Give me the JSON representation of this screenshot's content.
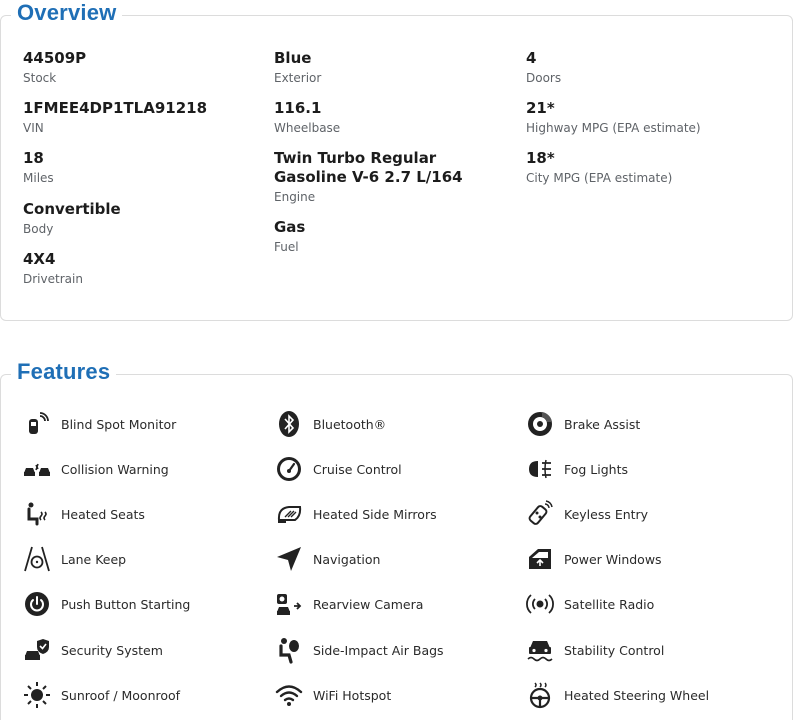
{
  "overview": {
    "title": "Overview",
    "specs": [
      {
        "value": "44509P",
        "label": "Stock"
      },
      {
        "value": "1FMEE4DP1TLA91218",
        "label": "VIN"
      },
      {
        "value": "18",
        "label": "Miles"
      },
      {
        "value": "Convertible",
        "label": "Body"
      },
      {
        "value": "4X4",
        "label": "Drivetrain"
      },
      {
        "value": "Blue",
        "label": "Exterior"
      },
      {
        "value": "116.1",
        "label": "Wheelbase"
      },
      {
        "value": "Twin Turbo Regular Gasoline V-6 2.7 L/164",
        "label": "Engine"
      },
      {
        "value": "Gas",
        "label": "Fuel"
      },
      {
        "value": "4",
        "label": "Doors"
      },
      {
        "value": "21*",
        "label": "Highway MPG (EPA estimate)"
      },
      {
        "value": "18*",
        "label": "City MPG (EPA estimate)"
      }
    ]
  },
  "features": {
    "title": "Features",
    "items": [
      {
        "label": "Blind Spot Monitor",
        "icon": "blind-spot-icon"
      },
      {
        "label": "Collision Warning",
        "icon": "collision-warning-icon"
      },
      {
        "label": "Heated Seats",
        "icon": "heated-seat-icon"
      },
      {
        "label": "Lane Keep",
        "icon": "lane-keep-icon"
      },
      {
        "label": "Push Button Starting",
        "icon": "power-button-icon"
      },
      {
        "label": "Security System",
        "icon": "security-shield-icon"
      },
      {
        "label": "Sunroof / Moonroof",
        "icon": "sun-icon"
      },
      {
        "label": "Bluetooth®",
        "icon": "bluetooth-icon"
      },
      {
        "label": "Cruise Control",
        "icon": "speedometer-icon"
      },
      {
        "label": "Heated Side Mirrors",
        "icon": "heated-mirror-icon"
      },
      {
        "label": "Navigation",
        "icon": "navigation-arrow-icon"
      },
      {
        "label": "Rearview Camera",
        "icon": "rearview-camera-icon"
      },
      {
        "label": "Side-Impact Air Bags",
        "icon": "airbag-icon"
      },
      {
        "label": "WiFi Hotspot",
        "icon": "wifi-icon"
      },
      {
        "label": "Brake Assist",
        "icon": "brake-disc-icon"
      },
      {
        "label": "Fog Lights",
        "icon": "fog-light-icon"
      },
      {
        "label": "Keyless Entry",
        "icon": "key-fob-icon"
      },
      {
        "label": "Power Windows",
        "icon": "power-window-icon"
      },
      {
        "label": "Satellite Radio",
        "icon": "satellite-radio-icon"
      },
      {
        "label": "Stability Control",
        "icon": "stability-control-icon"
      },
      {
        "label": "Heated Steering Wheel",
        "icon": "heated-steering-wheel-icon"
      }
    ]
  },
  "colors": {
    "accent": "#1f6fb6",
    "text": "#1c1c1c",
    "muted": "#5f6368",
    "border": "#dcdcdc"
  }
}
